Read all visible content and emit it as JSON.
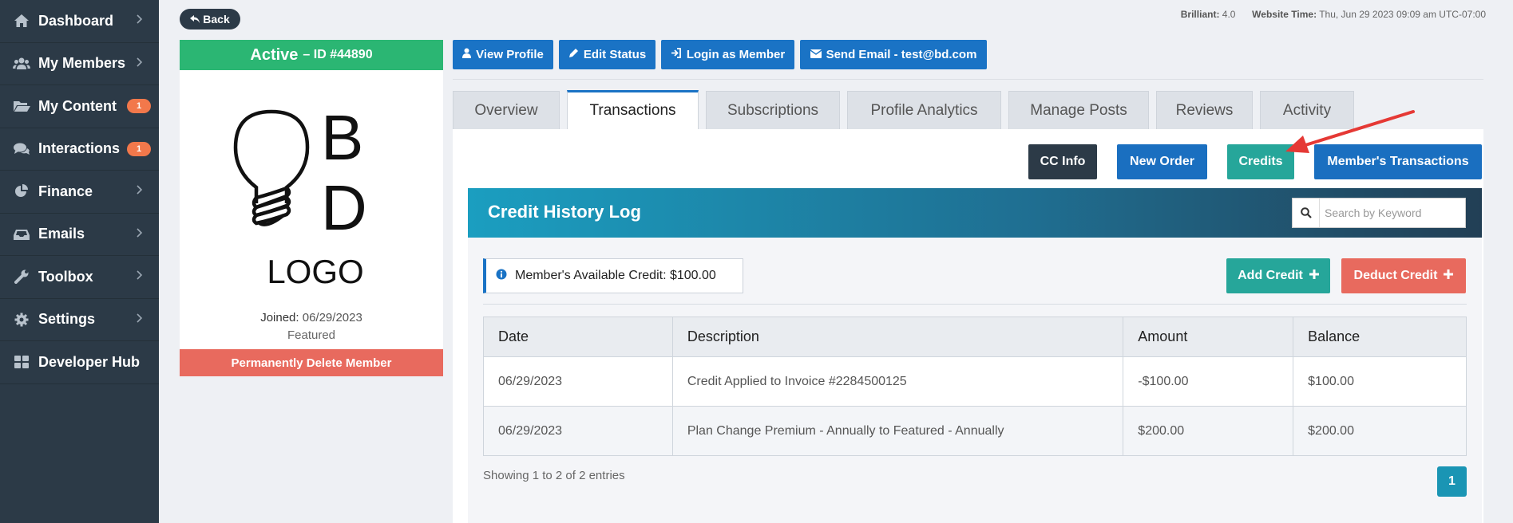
{
  "sidebar": {
    "items": [
      {
        "label": "Dashboard",
        "icon": "home-icon",
        "badge": ""
      },
      {
        "label": "My Members",
        "icon": "users-icon",
        "badge": ""
      },
      {
        "label": "My Content",
        "icon": "folder-icon",
        "badge": "1"
      },
      {
        "label": "Interactions",
        "icon": "comments-icon",
        "badge": "1"
      },
      {
        "label": "Finance",
        "icon": "pie-chart-icon",
        "badge": ""
      },
      {
        "label": "Emails",
        "icon": "inbox-icon",
        "badge": ""
      },
      {
        "label": "Toolbox",
        "icon": "wrench-icon",
        "badge": ""
      },
      {
        "label": "Settings",
        "icon": "gear-icon",
        "badge": ""
      },
      {
        "label": "Developer Hub",
        "icon": "grid-icon",
        "badge": ""
      }
    ]
  },
  "header": {
    "back_label": "Back",
    "version_label": "Brilliant:",
    "version_value": "4.0",
    "time_label": "Website Time:",
    "time_value": "Thu, Jun 29 2023 09:09 am UTC-07:00"
  },
  "profile": {
    "status": "Active",
    "id_text": "– ID #44890",
    "logo_letter_1": "B",
    "logo_letter_2": "D",
    "logo_word": "LOGO",
    "joined_label": "Joined:",
    "joined_value": "06/29/2023",
    "plan": "Featured",
    "delete_label": "Permanently Delete Member"
  },
  "actions": {
    "view_profile": "View Profile",
    "edit_status": "Edit Status",
    "login_as": "Login as Member",
    "send_email": "Send Email - test@bd.com"
  },
  "tabs": [
    "Overview",
    "Transactions",
    "Subscriptions",
    "Profile Analytics",
    "Manage Posts",
    "Reviews",
    "Activity"
  ],
  "panel_buttons": {
    "cc_info": "CC Info",
    "new_order": "New Order",
    "credits": "Credits",
    "member_transactions": "Member's Transactions"
  },
  "credit_log": {
    "title": "Credit History Log",
    "search_placeholder": "Search by Keyword",
    "available_label": "Member's Available Credit: $100.00",
    "add_credit": "Add Credit",
    "deduct_credit": "Deduct Credit",
    "columns": [
      "Date",
      "Description",
      "Amount",
      "Balance"
    ],
    "rows": [
      {
        "date": "06/29/2023",
        "description": "Credit Applied to Invoice #2284500125",
        "amount": "-$100.00",
        "balance": "$100.00"
      },
      {
        "date": "06/29/2023",
        "description": "Plan Change Premium - Annually to Featured - Annually",
        "amount": "$200.00",
        "balance": "$200.00"
      }
    ],
    "showing": "Showing 1 to 2 of 2 entries",
    "page": "1"
  },
  "colors": {
    "sidebar_bg": "#2c3a47",
    "active_green": "#2bb673",
    "primary_blue": "#1a73c5",
    "teal": "#26a69a",
    "danger": "#e86a5e",
    "badge_orange": "#f2784b",
    "annotation_arrow": "#e53935"
  }
}
